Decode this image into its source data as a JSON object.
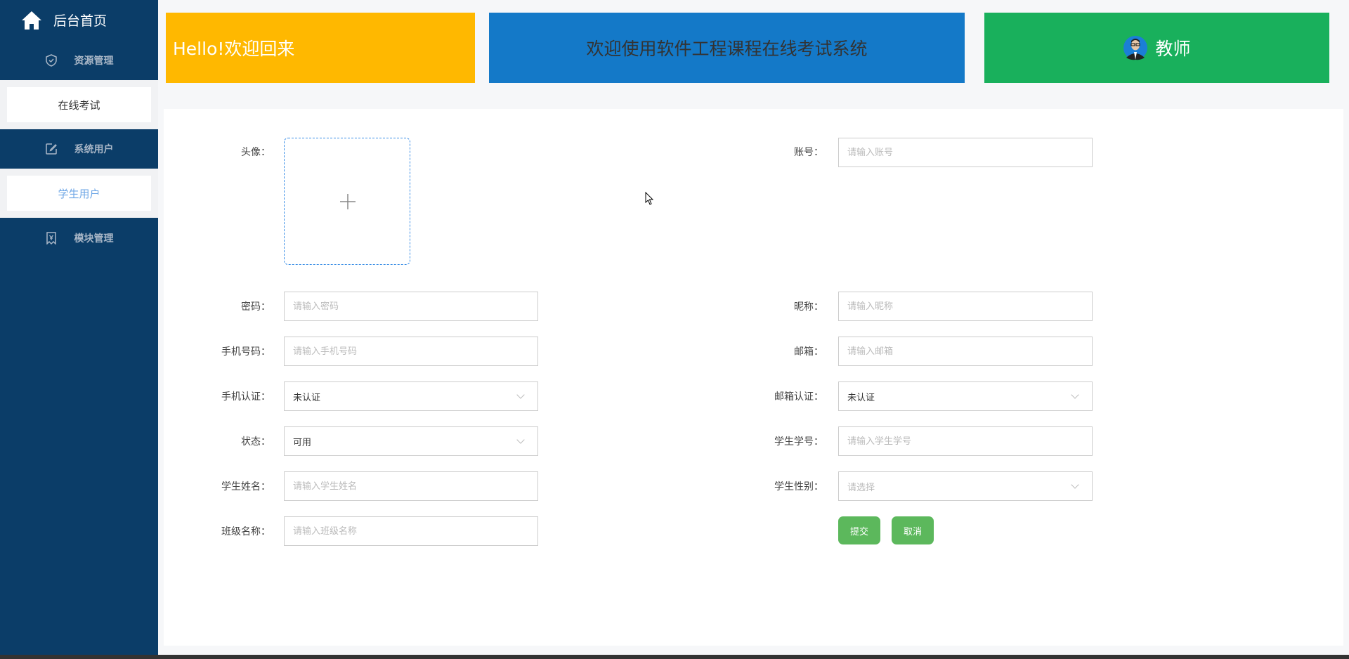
{
  "sidebar": {
    "home": "后台首页",
    "items": [
      {
        "label": "资源管理",
        "icon": "shield-check-icon"
      },
      {
        "label": "在线考试"
      },
      {
        "label": "系统用户",
        "icon": "edit-icon"
      },
      {
        "label": "学生用户"
      },
      {
        "label": "模块管理",
        "icon": "yen-bookmark-icon"
      }
    ]
  },
  "header": {
    "greeting": "Hello!欢迎回来",
    "system_title": "欢迎使用软件工程课程在线考试系统",
    "role": "教师"
  },
  "colors": {
    "sidebar": "#0b3d68",
    "yellow": "#ffb800",
    "blue": "#1479c8",
    "green": "#19b05c",
    "button": "#5cb85c",
    "active": "#6fa7e6"
  },
  "form": {
    "avatar_label": "头像：",
    "left": [
      {
        "label": "密码：",
        "placeholder": "请输入密码",
        "type": "input"
      },
      {
        "label": "手机号码：",
        "placeholder": "请输入手机号码",
        "type": "input"
      },
      {
        "label": "手机认证：",
        "value": "未认证",
        "type": "select"
      },
      {
        "label": "状态：",
        "value": "可用",
        "type": "select"
      },
      {
        "label": "学生姓名：",
        "placeholder": "请输入学生姓名",
        "type": "input"
      },
      {
        "label": "班级名称：",
        "placeholder": "请输入班级名称",
        "type": "input"
      }
    ],
    "account": {
      "label": "账号：",
      "placeholder": "请输入账号"
    },
    "right": [
      {
        "label": "昵称：",
        "placeholder": "请输入昵称",
        "type": "input"
      },
      {
        "label": "邮箱：",
        "placeholder": "请输入邮箱",
        "type": "input"
      },
      {
        "label": "邮箱认证：",
        "value": "未认证",
        "type": "select"
      },
      {
        "label": "学生学号：",
        "placeholder": "请输入学生学号",
        "type": "input"
      },
      {
        "label": "学生性别：",
        "placeholder": "请选择",
        "type": "select"
      }
    ],
    "submit": "提交",
    "cancel": "取消"
  }
}
